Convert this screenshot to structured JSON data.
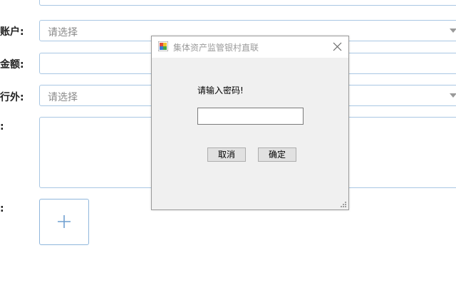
{
  "form": {
    "account_label": "账户:",
    "account_placeholder": "请选择",
    "amount_label": "金额:",
    "inside_outside_label": "行外:",
    "inside_outside_placeholder": "请选择",
    "remark_label": ":",
    "attachment_label": ":"
  },
  "dialog": {
    "title": "集体资产监管银村直联",
    "prompt": "请输入密码!",
    "password_value": "",
    "cancel_label": "取消",
    "ok_label": "确定"
  },
  "colors": {
    "field_border": "#a9c7e3",
    "dialog_bg": "#f0f0f0",
    "button_bg": "#e1e1e1"
  }
}
